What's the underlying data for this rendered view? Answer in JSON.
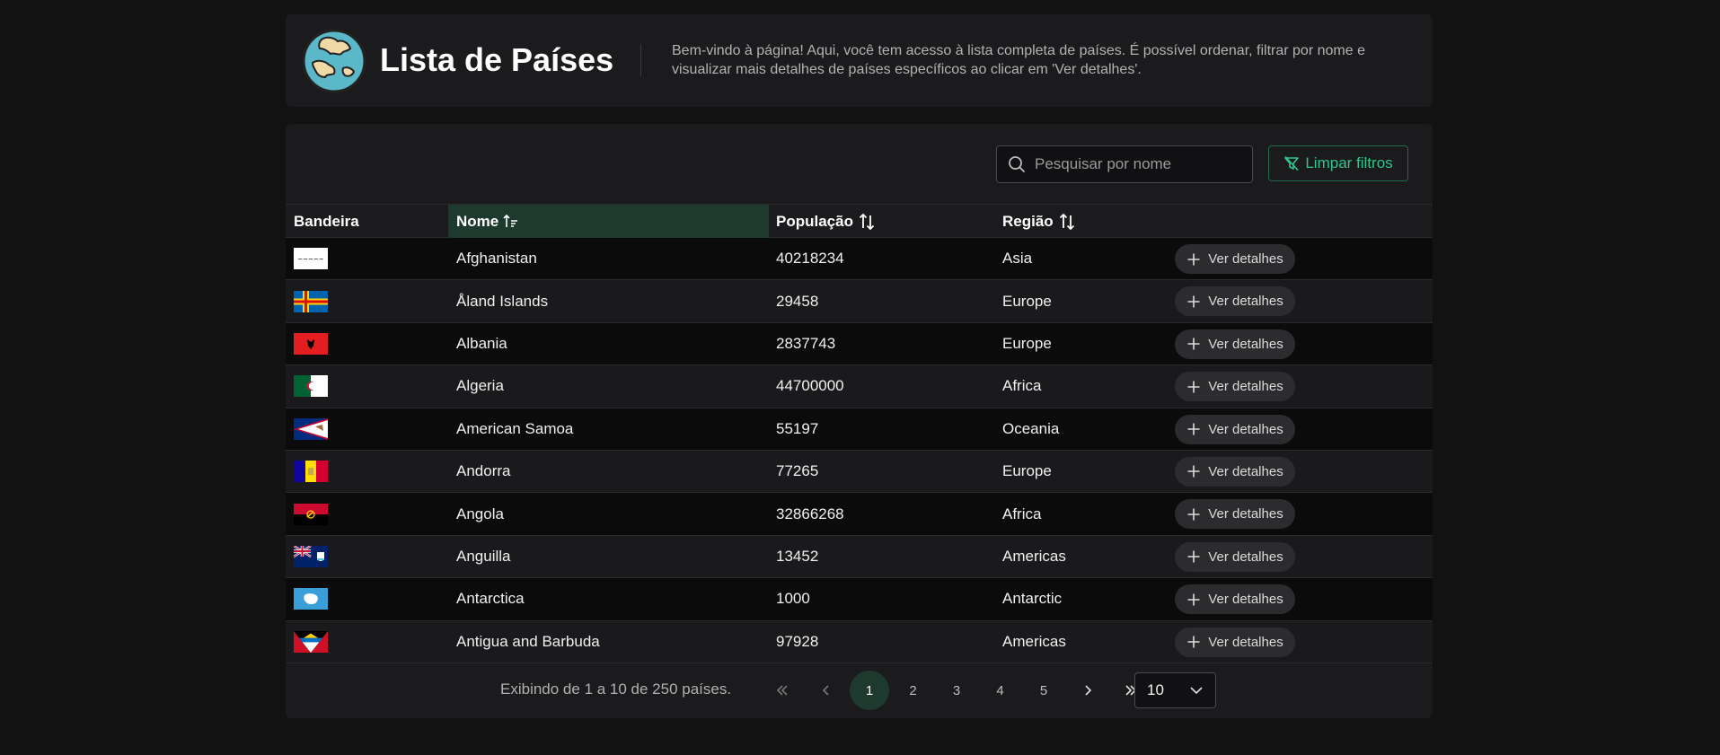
{
  "header": {
    "title": "Lista de Países",
    "description": "Bem-vindo à página! Aqui, você tem acesso à lista completa de países. É possível ordenar, filtrar por nome e visualizar mais detalhes de países específicos ao clicar em 'Ver detalhes'."
  },
  "toolbar": {
    "search_placeholder": "Pesquisar por nome",
    "clear_label": "Limpar filtros"
  },
  "table": {
    "columns": {
      "flag": "Bandeira",
      "name": "Nome",
      "population": "População",
      "region": "Região"
    },
    "details_label": "Ver detalhes",
    "rows": [
      {
        "name": "Afghanistan",
        "population": "40218234",
        "region": "Asia",
        "flag": "afghanistan"
      },
      {
        "name": "Åland Islands",
        "population": "29458",
        "region": "Europe",
        "flag": "aland"
      },
      {
        "name": "Albania",
        "population": "2837743",
        "region": "Europe",
        "flag": "albania"
      },
      {
        "name": "Algeria",
        "population": "44700000",
        "region": "Africa",
        "flag": "algeria"
      },
      {
        "name": "American Samoa",
        "population": "55197",
        "region": "Oceania",
        "flag": "american-samoa"
      },
      {
        "name": "Andorra",
        "population": "77265",
        "region": "Europe",
        "flag": "andorra"
      },
      {
        "name": "Angola",
        "population": "32866268",
        "region": "Africa",
        "flag": "angola"
      },
      {
        "name": "Anguilla",
        "population": "13452",
        "region": "Americas",
        "flag": "anguilla"
      },
      {
        "name": "Antarctica",
        "population": "1000",
        "region": "Antarctic",
        "flag": "antarctica"
      },
      {
        "name": "Antigua and Barbuda",
        "population": "97928",
        "region": "Americas",
        "flag": "antigua"
      }
    ]
  },
  "pagination": {
    "info": "Exibindo de 1 a 10 de 250 países.",
    "pages": [
      "1",
      "2",
      "3",
      "4",
      "5"
    ],
    "current_page": "1",
    "per_page": "10"
  },
  "colors": {
    "accent": "#34c48b",
    "sorted_header_bg": "#1e3a2f",
    "background": "#121212"
  }
}
